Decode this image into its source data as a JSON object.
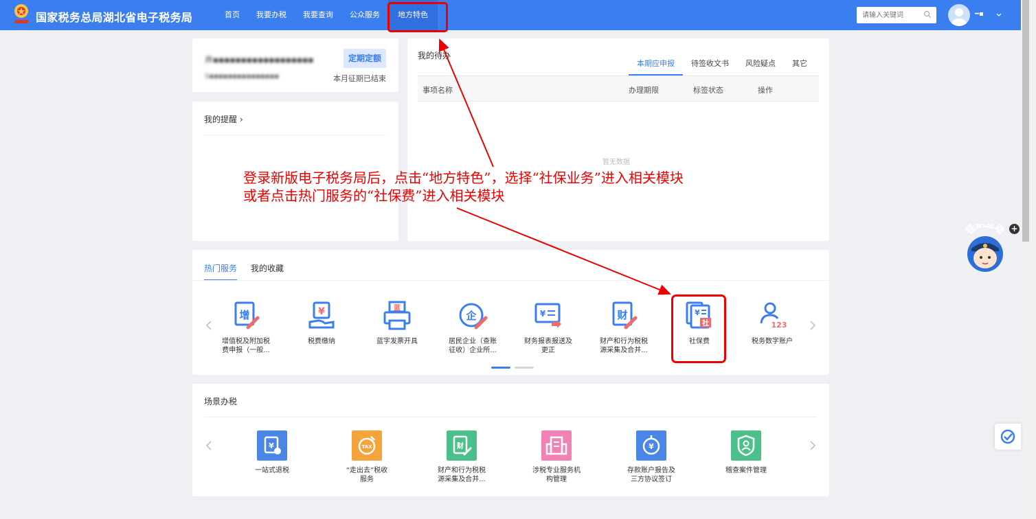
{
  "header": {
    "title": "国家税务总局湖北省电子税务局",
    "nav": [
      "首页",
      "我要办税",
      "我要查询",
      "公众服务",
      "地方特色"
    ],
    "search_placeholder": "请输入关键词",
    "user_name": "━▪"
  },
  "company": {
    "name": "井▪▪▪▪▪▪▪▪▪▪▪▪▪▪▪▪▪▪",
    "id": "S▪▪▪▪▪▪▪▪▪▪▪▪▪▪▪",
    "tag": "定期定额",
    "status": "本月征期已结束"
  },
  "reminder": {
    "title": "我的提醒 ›"
  },
  "todo": {
    "title": "我的待办",
    "tabs": [
      "本期应申报",
      "待签收文书",
      "风险疑点",
      "其它"
    ],
    "columns": [
      "事项名称",
      "办理期限",
      "标签状态",
      "操作"
    ],
    "empty": "暂无数据"
  },
  "hot": {
    "tabs": [
      "热门服务",
      "我的收藏"
    ],
    "services": [
      {
        "l1": "增值税及附加税",
        "l2": "费申报（一般..."
      },
      {
        "l1": "税费缴纳",
        "l2": ""
      },
      {
        "l1": "蓝字发票开具",
        "l2": ""
      },
      {
        "l1": "居民企业（查账",
        "l2": "征收）企业所..."
      },
      {
        "l1": "财务报表报送及",
        "l2": "更正"
      },
      {
        "l1": "财产和行为税税",
        "l2": "源采集及合并..."
      },
      {
        "l1": "社保费",
        "l2": ""
      },
      {
        "l1": "税务数字账户",
        "l2": ""
      }
    ]
  },
  "scene": {
    "title": "场景办税",
    "items": [
      {
        "l1": "一站式退税",
        "l2": "",
        "color": "#4a86e8"
      },
      {
        "l1": "“走出去”税收",
        "l2": "服务",
        "color": "#f5a43c"
      },
      {
        "l1": "财产和行为税税",
        "l2": "源采集及合并...",
        "color": "#4cc08a"
      },
      {
        "l1": "涉税专业服务机",
        "l2": "构管理",
        "color": "#f082b4"
      },
      {
        "l1": "存款账户报告及",
        "l2": "三方协议签订",
        "color": "#4a86e8"
      },
      {
        "l1": "稽查案件管理",
        "l2": "",
        "color": "#4cc08a"
      }
    ]
  },
  "annotation": {
    "line1": "登录新版电子税务局后，点击“地方特色”，选择“社保业务”进入相关模块",
    "line2": "或者点击热门服务的“社保费”进入相关模块"
  },
  "assistant": {
    "label": "征纳互动"
  },
  "colors": {
    "primary": "#3b7ef0",
    "annotation": "#ee0000"
  }
}
